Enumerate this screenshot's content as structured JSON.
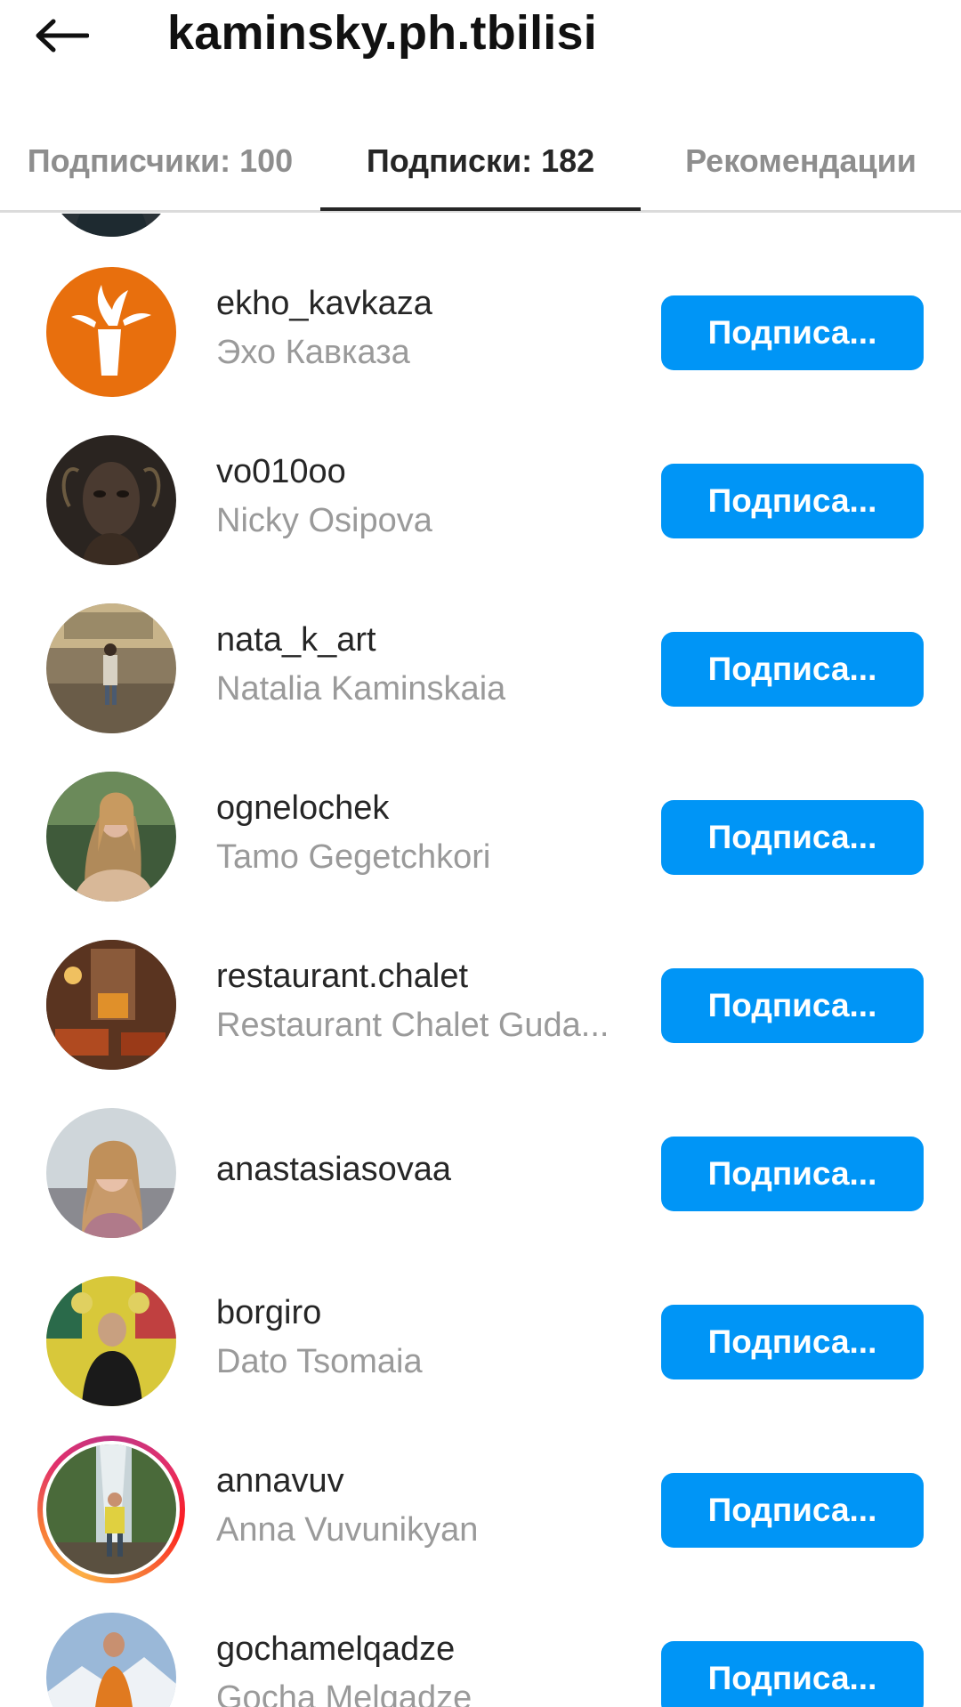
{
  "header": {
    "title": "kaminsky.ph.tbilisi",
    "back_icon": "arrow-left-icon"
  },
  "tabs": [
    {
      "label": "Подписчики: 100",
      "active": false
    },
    {
      "label": "Подписки: 182",
      "active": true
    },
    {
      "label": "Рекомендации",
      "active": false
    }
  ],
  "accounts": [
    {
      "username": "ekho_kavkaza",
      "fullname": "Эхо Кавказа",
      "button": "Подписа..."
    },
    {
      "username": "vo010oo",
      "fullname": "Nicky Osipova",
      "button": "Подписа..."
    },
    {
      "username": "nata_k_art",
      "fullname": "Natalia  Kaminskaia",
      "button": "Подписа..."
    },
    {
      "username": "ognelochek",
      "fullname": "Tamo Gegetchkori",
      "button": "Подписа..."
    },
    {
      "username": "restaurant.chalet",
      "fullname": "Restaurant  Chalet Guda...",
      "button": "Подписа..."
    },
    {
      "username": "anastasiasovaa",
      "fullname": "",
      "button": "Подписа..."
    },
    {
      "username": "borgiro",
      "fullname": "Dato Tsomaia",
      "button": "Подписа..."
    },
    {
      "username": "annavuv",
      "fullname": "Anna Vuvunikyan",
      "button": "Подписа...",
      "story_ring": true
    },
    {
      "username": "gochamelqadze",
      "fullname": "Gocha Melgadze",
      "button": "Подписа..."
    }
  ],
  "colors": {
    "accent": "#0095f6",
    "text": "#262626",
    "secondary_text": "#9a9a9a",
    "inactive_tab": "#8e8e8e"
  }
}
